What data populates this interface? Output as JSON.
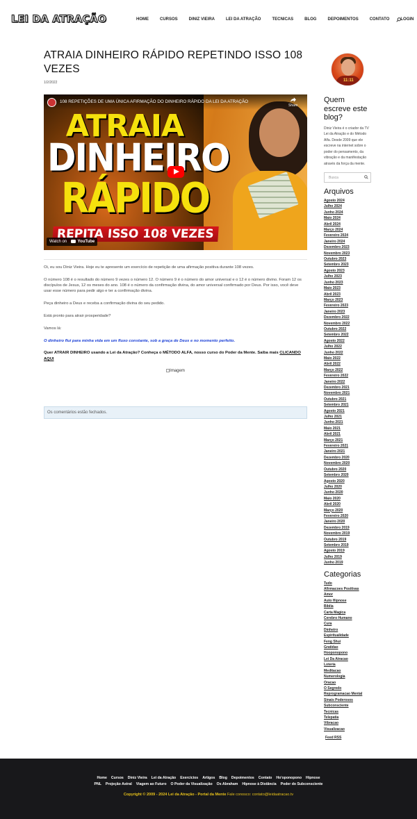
{
  "header": {
    "logo": "LEI DA ATRAÇÃO",
    "nav": [
      "HOME",
      "CURSOS",
      "DINIZ VIEIRA",
      "LEI DA ATRAÇÃO",
      "TECNICAS",
      "BLOG",
      "DEPOIMENTOS",
      "CONTATO",
      "LOGIN"
    ]
  },
  "post": {
    "title": "ATRAIA DINHEIRO RÁPIDO REPETINDO ISSO 108 VEZES",
    "date": "1/2/2022",
    "video": {
      "title": "108 REPETIÇÕES DE UMA ÚNICA AFIRMAÇÃO DO DINHEIRO RÁPIDO DA LEI DA ATRAÇÃO",
      "share": "Share",
      "line1": "ATRAIA",
      "line2": "DINHEIRO",
      "line3": "RÁPIDO",
      "line4": "REPITA ISSO 108 VEZES",
      "watch_on": "Watch on",
      "youtube": "YouTube"
    },
    "paragraphs": [
      "Oi, eu sou Diniz Vieira. Hoje eu te apresento um exercício de repetição de uma afirmação positiva durante 108 vezes.",
      "O número 108 é o resultado do número 9 vezes o número 12. O número 9 é o número do amor universal e o 12 é o número divino. Foram 12 os discípulos de Jesus, 12 os meses do ano. 108 é o número da confirmação divina, do amor universal confirmado por Deus. Por isso, você deve usar esse número para pedir algo e ter a confirmação divina.",
      "Peça dinheiro a Deus e receba a confirmação divina do seu pedido.",
      "Está pronto para atrair prosperidade?",
      "Vamos lá:"
    ],
    "affirmation": "O dinheiro flui para minha vida em um fluxo constante, sob a graça de Deus e no momento perfeito.",
    "cta_text": "Quer ATRAIR DINHEIRO usando a Lei da Atração? Conheça o MÉTODO ALFA, nosso curso do Poder da Mente. Saiba mais ",
    "cta_link": "CLICANDO AQUI",
    "image_alt": "Imagem",
    "comments_closed": "Os comentários estão fechados."
  },
  "sidebar": {
    "avatar_text": "11:11",
    "about_title": "Quem escreve este blog?",
    "about_text": "Diniz Vieira é o criador da TV Lei da Atração e do Método Alfa. Desde 2009 que ele escreve na internet sobre o poder do pensamento, da vibração e da manifestação através da força da mente.",
    "search_placeholder": "Busca",
    "archives_title": "Arquivos",
    "archives": [
      "Agosto 2024",
      "Julho 2024",
      "Junho 2024",
      "Maio 2024",
      "Abril 2024",
      "Março 2024",
      "Fevereiro 2024",
      "Janeiro 2024",
      "Dezembro 2023",
      "Novembro 2023",
      "Outubro 2023",
      "Setembro 2023",
      "Agosto 2023",
      "Julho 2023",
      "Junho 2023",
      "Maio 2023",
      "Abril 2023",
      "Março 2023",
      "Fevereiro 2023",
      "Janeiro 2023",
      "Dezembro 2022",
      "Novembro 2022",
      "Outubro 2022",
      "Setembro 2022",
      "Agosto 2022",
      "Julho 2022",
      "Junho 2022",
      "Maio 2022",
      "Abril 2022",
      "Março 2022",
      "Fevereiro 2022",
      "Janeiro 2022",
      "Dezembro 2021",
      "Novembro 2021",
      "Outubro 2021",
      "Setembro 2021",
      "Agosto 2021",
      "Julho 2021",
      "Junho 2021",
      "Maio 2021",
      "Abril 2021",
      "Março 2021",
      "Fevereiro 2021",
      "Janeiro 2021",
      "Dezembro 2020",
      "Novembro 2020",
      "Outubro 2020",
      "Setembro 2020",
      "Agosto 2020",
      "Julho 2020",
      "Junho 2020",
      "Maio 2020",
      "Abril 2020",
      "Março 2020",
      "Fevereiro 2020",
      "Janeiro 2020",
      "Dezembro 2019",
      "Novembro 2019",
      "Outubro 2019",
      "Setembro 2019",
      "Agosto 2019",
      "Julho 2019",
      "Junho 2019"
    ],
    "categories_title": "Categorias",
    "categories": [
      "Tudo",
      "Afirmacoes Positivas",
      "Amor",
      "Auto Hipnose",
      "Bíblia",
      "Carta Magica",
      "Cerebro Humano",
      "Cura",
      "Dinheiro",
      "Espiritualidade",
      "Feng Shui",
      "Gratidao",
      "Hooponopono",
      "Lei Da Atracao",
      "Loteria",
      "Meditacao",
      "Numerologia",
      "Oracao",
      "O Segredo",
      "Reprogramacao Mental",
      "Sinais Poderosos",
      "Subconsciente",
      "Tecnicas",
      "Telepatia",
      "Vibracao",
      "Visualizacao"
    ],
    "feed": "Feed RSS"
  },
  "footer": {
    "nav_row1": [
      "Home",
      "Cursos",
      "Diniz Vieira",
      "Lei da Atração",
      "Exercícios",
      "Artigos",
      "Blog",
      "Depoimentos",
      "Contato",
      "Ho'oponopono",
      "Hipnose"
    ],
    "nav_row2": [
      "PNL",
      "Projeção Astral",
      "Viagem ao Futuro",
      "O Poder da Visualização",
      "Os Abraham",
      "Hipnose à Distância",
      "Poder do Subconsciente"
    ],
    "copyright": "Copyright © 2009 - 2024 Lei da Atração - Portal da Mente",
    "contact": "Fale conosco: contato@leidaatracao.tv"
  }
}
